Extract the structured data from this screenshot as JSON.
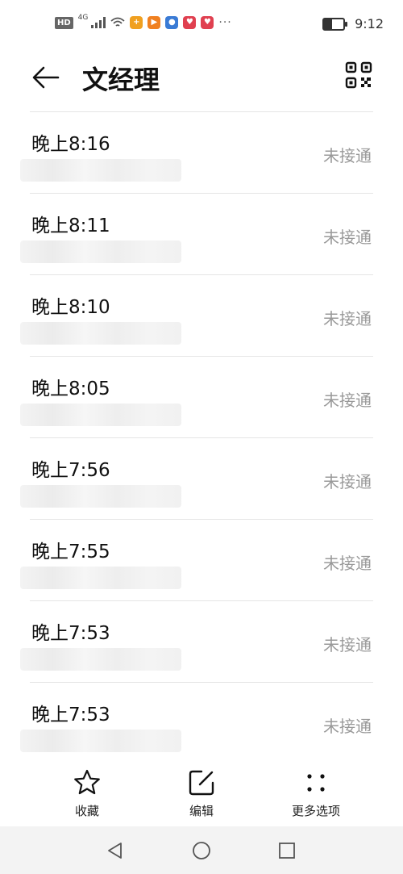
{
  "status_bar": {
    "hd": "HD",
    "network": "4G",
    "time": "9:12",
    "more": "···",
    "battery_level": 0.4
  },
  "header": {
    "title": "文经理",
    "back_icon": "arrow-left-icon",
    "qr_icon": "qr-code-icon"
  },
  "call_log": [
    {
      "time": "晚上8:16",
      "status": "未接通"
    },
    {
      "time": "晚上8:11",
      "status": "未接通"
    },
    {
      "time": "晚上8:10",
      "status": "未接通"
    },
    {
      "time": "晚上8:05",
      "status": "未接通"
    },
    {
      "time": "晚上7:56",
      "status": "未接通"
    },
    {
      "time": "晚上7:55",
      "status": "未接通"
    },
    {
      "time": "晚上7:53",
      "status": "未接通"
    },
    {
      "time": "晚上7:53",
      "status": "未接通"
    }
  ],
  "actions": {
    "favorite": "收藏",
    "edit": "编辑",
    "more": "更多选项"
  },
  "colors": {
    "status_text": "#999999",
    "divider": "#e5e5e5",
    "nav_bg": "#f3f3f3"
  }
}
